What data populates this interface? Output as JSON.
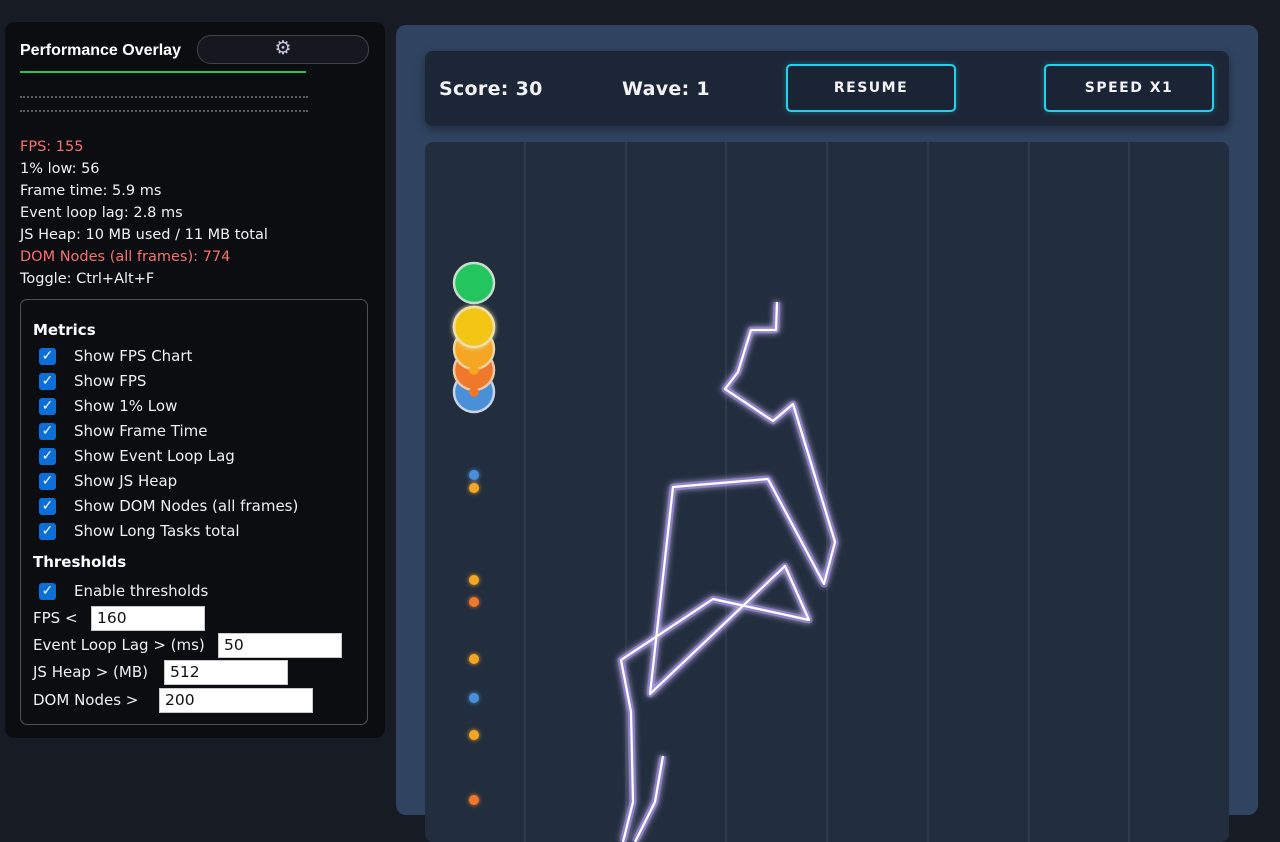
{
  "overlay": {
    "title": "Performance Overlay",
    "settings_icon": "gear-icon",
    "stats": {
      "fps": "FPS: 155",
      "low1": "1% low: 56",
      "frame_time": "Frame time: 5.9 ms",
      "event_loop_lag": "Event loop lag: 2.8 ms",
      "js_heap": "JS Heap: 10 MB used / 11 MB total",
      "dom_nodes": "DOM Nodes (all frames): 774",
      "toggle": "Toggle: Ctrl+Alt+F"
    },
    "metrics_heading": "Metrics",
    "metrics": [
      {
        "label": "Show FPS Chart",
        "checked": true
      },
      {
        "label": "Show FPS",
        "checked": true
      },
      {
        "label": "Show 1% Low",
        "checked": true
      },
      {
        "label": "Show Frame Time",
        "checked": true
      },
      {
        "label": "Show Event Loop Lag",
        "checked": true
      },
      {
        "label": "Show JS Heap",
        "checked": true
      },
      {
        "label": "Show DOM Nodes (all frames)",
        "checked": true
      },
      {
        "label": "Show Long Tasks total",
        "checked": true
      }
    ],
    "thresholds_heading": "Thresholds",
    "enable_thresholds": {
      "label": "Enable thresholds",
      "checked": true
    },
    "thresholds": [
      {
        "label": "FPS <",
        "value": "160"
      },
      {
        "label": "Event Loop Lag > (ms)",
        "value": "50"
      },
      {
        "label": "JS Heap > (MB)",
        "value": "512"
      },
      {
        "label": "DOM Nodes >",
        "value": "200"
      }
    ],
    "colors": {
      "accent": "#22c55e",
      "warning": "#f87171",
      "checkbox": "#0c6fd8"
    }
  },
  "game": {
    "score": "Score: 30",
    "wave": "Wave: 1",
    "resume_label": "RESUME",
    "speed_label": "SPEED X1",
    "colors": {
      "button_border": "#22d3ee",
      "panel": "#304461",
      "field": "#222d3e",
      "path_glow": "#a78bfa"
    }
  }
}
